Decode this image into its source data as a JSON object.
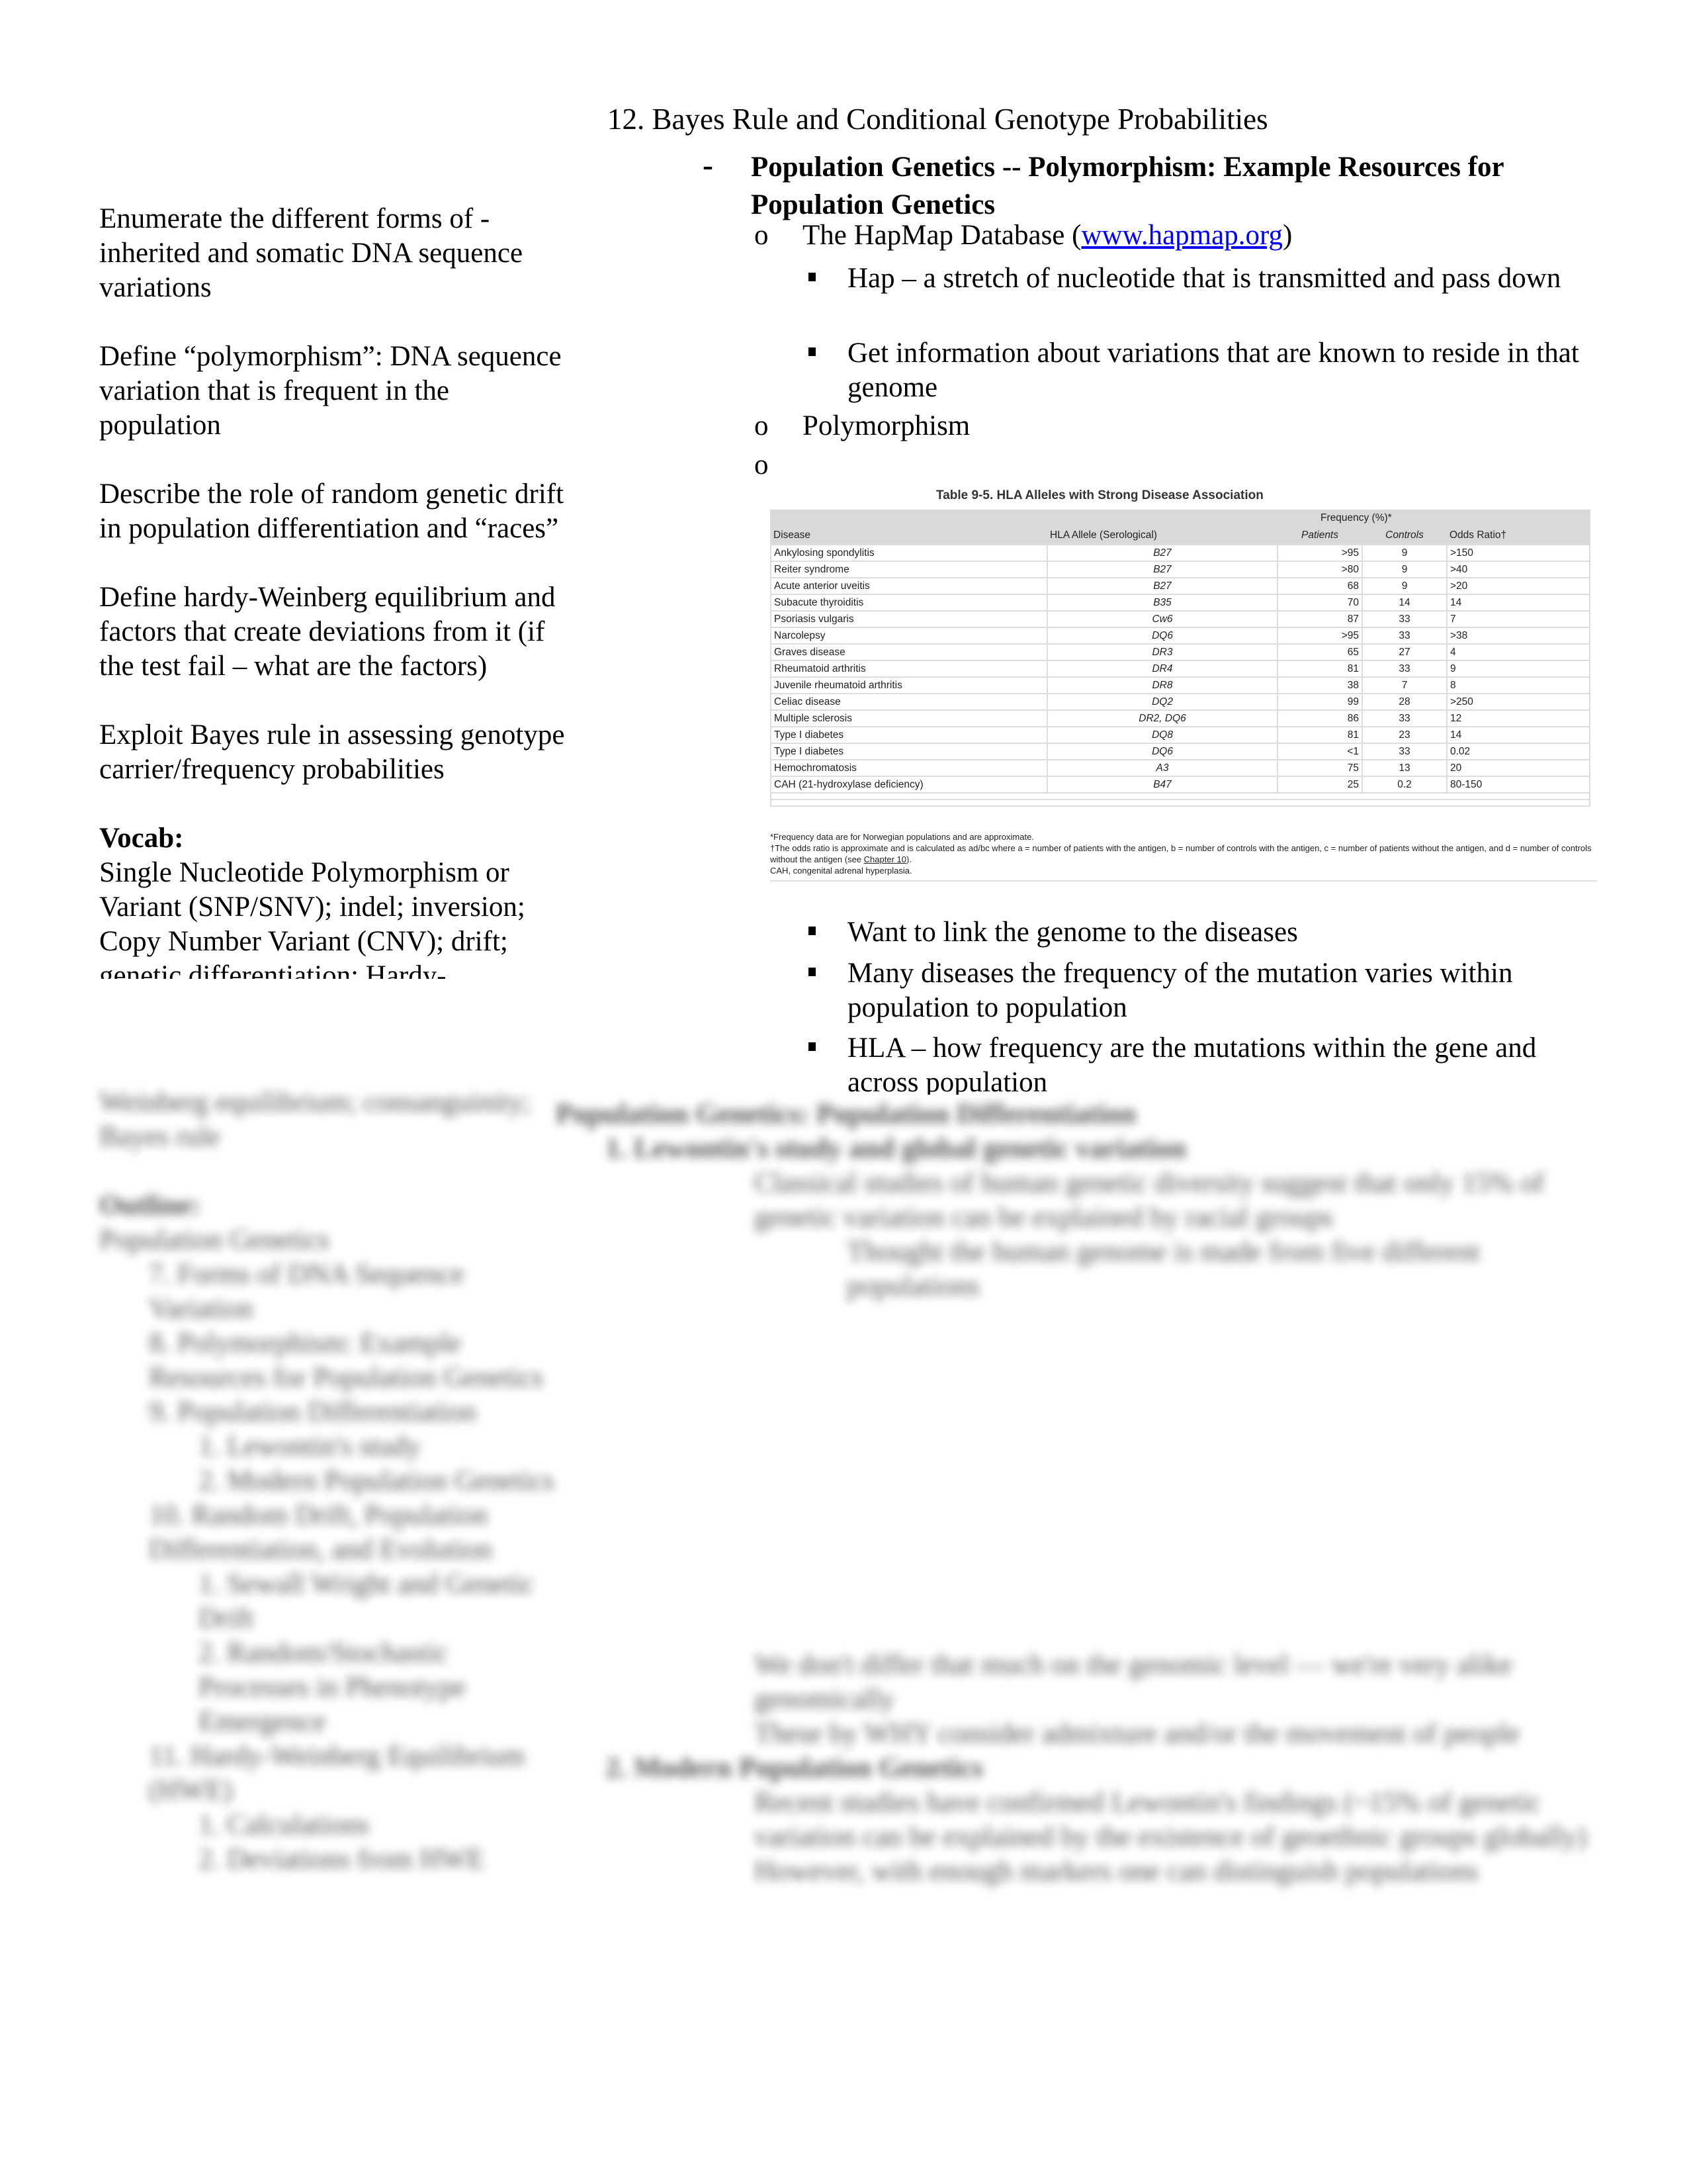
{
  "left_column": {
    "objectives": [
      "Enumerate the different forms of - inherited and somatic DNA sequence variations",
      "Define “polymorphism”: DNA sequence variation that is frequent in the population",
      "Describe the role of random genetic drift in population differentiation and “races”",
      "Define hardy-Weinberg equilibrium and factors that create deviations from it (if the test fail – what are the factors)",
      "Exploit Bayes rule in assessing genotype carrier/frequency probabilities"
    ],
    "vocab_heading": "Vocab:",
    "vocab_text": "Single Nucleotide Polymorphism or Variant (SNP/SNV); indel; inversion; Copy Number Variant (CNV); drift;",
    "vocab_text_cut": "genetic differentiation; Hardy-",
    "blurred": {
      "vocab_rest": "Weinberg equilibrium; consanguinity; Bayes rule",
      "outline_heading": "Outline:",
      "outline_sub": "Population Genetics",
      "outline_items": [
        "7.  Forms of DNA Sequence Variation",
        "8.  Polymorphism: Example Resources for Population Genetics",
        "9.  Population Differentiation",
        "1.  Lewontin's study",
        "2.  Modern Population Genetics",
        "10. Random Drift, Population Differentiation, and Evolution",
        "1.  Sewall Wright and Genetic Drift",
        "2.  Random/Stochastic Processes in Phenotype Emergence",
        "11. Hardy-Weinberg Equilibrium (HWE)",
        "1.  Calculations",
        "2.  Deviations from HWE"
      ]
    }
  },
  "right_column": {
    "title": "12. Bayes Rule and Conditional Genotype Probabilities",
    "section_bullet": "-",
    "section_title": "Population Genetics -- Polymorphism: Example Resources for Population Genetics",
    "items": {
      "hapmap_prefix": "The HapMap Database (",
      "hapmap_link": "www.hapmap.org",
      "hapmap_suffix": ")",
      "hap_def": "Hap – a stretch of nucleotide that is transmitted and pass down",
      "hap_info": "Get information about variations that are known to reside in that genome",
      "polymorphism": "Polymorphism",
      "empty_bullet": ""
    },
    "circle_bullet": "o",
    "after_table": [
      "Want to link the genome to the diseases",
      "Many diseases the frequency of the mutation varies within population to population",
      "HLA – how frequency are the mutations within the gene and across population"
    ],
    "blurred": {
      "heading": "Population Genetics: Population Differentiation",
      "sub1": "1.   Lewontin's study and global genetic variation",
      "sub1_a": "Classical studies of human genetic diversity suggest that only 15% of genetic variation can be explained by racial groups",
      "sub1_a_i": "Thought the human genome is made from five different populations",
      "sub1_b": "We don't differ that much on the genomic level — we're very alike genomically",
      "sub1_c": "These by WHY consider admixture and/or the movement of people",
      "sub2": "2.   Modern Population Genetics",
      "sub2_a": "Recent studies have confirmed Lewontin's findings (~15% of genetic variation can be explained by the existence of geoethnic groups globally)",
      "sub2_b": "However, with enough markers one can distinguish populations"
    }
  },
  "table": {
    "caption": "Table 9-5. HLA Alleles with Strong Disease Association",
    "group_header": "Frequency (%)*",
    "columns": [
      "Disease",
      "HLA Allele (Serological)",
      "Patients",
      "Controls",
      "Odds Ratio†"
    ],
    "rows": [
      [
        "Ankylosing spondylitis",
        "B27",
        ">95",
        "9",
        ">150"
      ],
      [
        "Reiter syndrome",
        "B27",
        ">80",
        "9",
        ">40"
      ],
      [
        "Acute anterior uveitis",
        "B27",
        "68",
        "9",
        ">20"
      ],
      [
        "Subacute thyroiditis",
        "B35",
        "70",
        "14",
        "14"
      ],
      [
        "Psoriasis vulgaris",
        "Cw6",
        "87",
        "33",
        "7"
      ],
      [
        "Narcolepsy",
        "DQ6",
        ">95",
        "33",
        ">38"
      ],
      [
        "Graves disease",
        "DR3",
        "65",
        "27",
        "4"
      ],
      [
        "Rheumatoid arthritis",
        "DR4",
        "81",
        "33",
        "9"
      ],
      [
        "Juvenile rheumatoid arthritis",
        "DR8",
        "38",
        "7",
        "8"
      ],
      [
        "Celiac disease",
        "DQ2",
        "99",
        "28",
        ">250"
      ],
      [
        "Multiple sclerosis",
        "DR2, DQ6",
        "86",
        "33",
        "12"
      ],
      [
        "Type I diabetes",
        "DQ8",
        "81",
        "23",
        "14"
      ],
      [
        "Type I diabetes",
        "DQ6",
        "<1",
        "33",
        "0.02"
      ],
      [
        "Hemochromatosis",
        "A3",
        "75",
        "13",
        "20"
      ],
      [
        "CAH (21-hydroxylase deficiency)",
        "B47",
        "25",
        "0.2",
        "80-150"
      ]
    ],
    "notes": {
      "n1": "*Frequency data are for Norwegian populations and are approximate.",
      "n2_pre": "†The odds ratio is approximate and is calculated as ad/bc where a = number of patients with the antigen, b = number of controls with the antigen, c = number of patients without the antigen, and d = number of controls without the antigen (see ",
      "n2_link": "Chapter 10",
      "n2_post": ").",
      "n3": "CAH, congenital adrenal hyperplasia."
    }
  }
}
